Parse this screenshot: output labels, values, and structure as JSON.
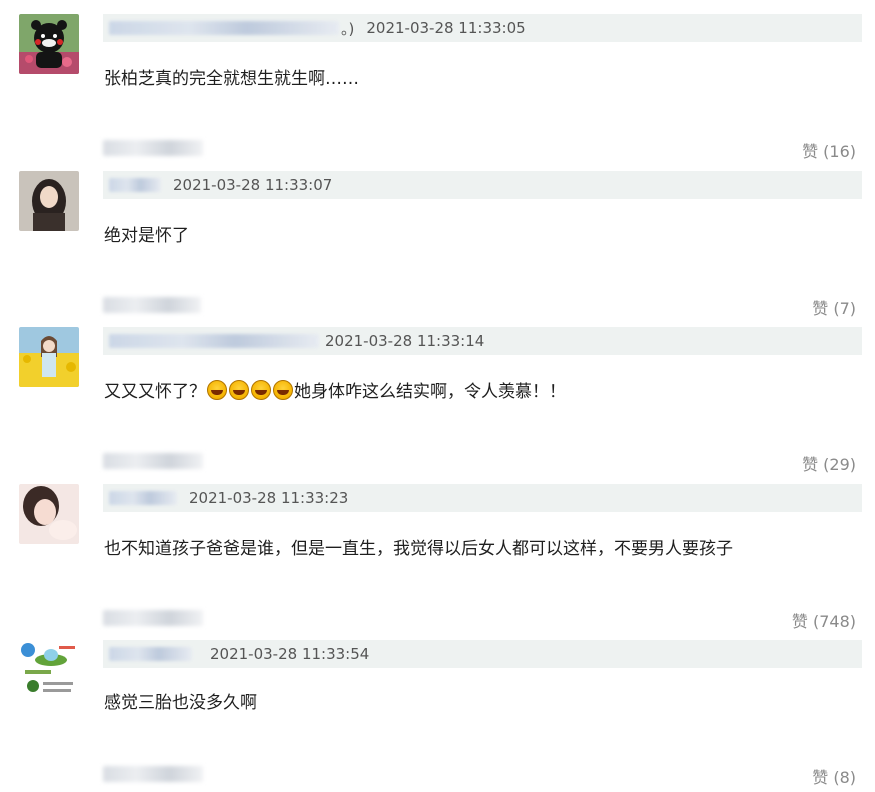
{
  "comments": [
    {
      "tail": "。)",
      "time": "2021-03-28 11:33:05",
      "text": "张柏芝真的完全就想生就生啊……",
      "likes": "赞 (16)"
    },
    {
      "tail": "",
      "time": "2021-03-28 11:33:07",
      "text": "绝对是怀了",
      "likes": "赞 (7)"
    },
    {
      "tail": "",
      "time": "2021-03-28 11:33:14",
      "text_prefix": "又又又怀了？",
      "emoji_name": "grinning-sweat-emoji",
      "text_suffix": "她身体咋这么结实啊，令人羡慕！！",
      "likes": "赞 (29)"
    },
    {
      "tail": "",
      "time": "2021-03-28 11:33:23",
      "text": "也不知道孩子爸爸是谁，但是一直生，我觉得以后女人都可以这样，不要男人要孩子",
      "likes": "赞 (748)"
    },
    {
      "tail": "",
      "time": "2021-03-28 11:33:54",
      "text": "感觉三胎也没多久啊",
      "likes": "赞 (8)"
    }
  ]
}
